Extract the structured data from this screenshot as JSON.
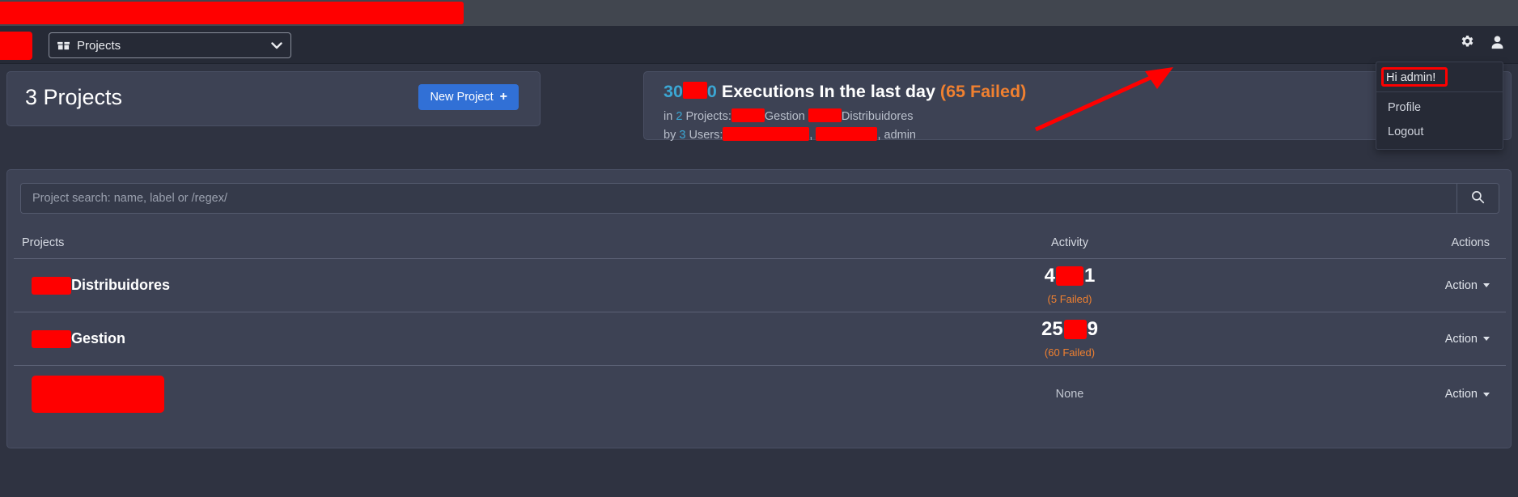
{
  "topbar": {
    "redacted": true
  },
  "navbar": {
    "project_selector": {
      "label": "Projects",
      "icon": "box-icon",
      "chevron": "chevron-down-icon"
    },
    "gear_icon": "gear-icon",
    "user_icon": "user-icon",
    "brand_redacted": true
  },
  "user_menu": {
    "greeting": "Hi admin!",
    "items": [
      {
        "label": "Profile"
      },
      {
        "label": "Logout"
      }
    ],
    "highlight_color": "#ff0000"
  },
  "annotation": {
    "arrow_color": "#ff0000",
    "points_to": "Hi admin!"
  },
  "projects_panel": {
    "title": "3 Projects",
    "new_project_button": {
      "label": "New Project",
      "plus": "+",
      "color": "#3170d6"
    }
  },
  "executions_panel": {
    "count_prefix": "30",
    "count_suffix": "0",
    "headline": "Executions In the last day",
    "failed": "(65 Failed)",
    "projects_line": {
      "prefix": "in",
      "count": "2",
      "word": "Projects:",
      "names": [
        "Gestion",
        "Distribuidores"
      ]
    },
    "users_line": {
      "prefix": "by",
      "count": "3",
      "word": "Users:",
      "separator_1": ",",
      "separator_2": ",",
      "visible_user": "admin"
    },
    "accent_color": "#3ba7d4",
    "failed_color": "#f08030"
  },
  "search": {
    "placeholder": "Project search: name, label or /regex/",
    "value": "",
    "button_icon": "search-icon"
  },
  "table": {
    "columns": [
      "Projects",
      "Activity",
      "Actions"
    ],
    "rows": [
      {
        "name": "Distribuidores",
        "name_redacted": true,
        "name_style": "label",
        "activity_prefix": "4",
        "activity_suffix": "1",
        "activity_redacted_width": 34,
        "failed": "(5 Failed)",
        "action_label": "Action"
      },
      {
        "name": "Gestion",
        "name_redacted": true,
        "name_style": "label",
        "activity_prefix": "25",
        "activity_suffix": "9",
        "activity_redacted_width": 28,
        "failed": "(60 Failed)",
        "action_label": "Action"
      },
      {
        "name": "",
        "name_redacted": true,
        "name_style": "block",
        "activity_none": "None",
        "action_label": "Action"
      }
    ]
  }
}
